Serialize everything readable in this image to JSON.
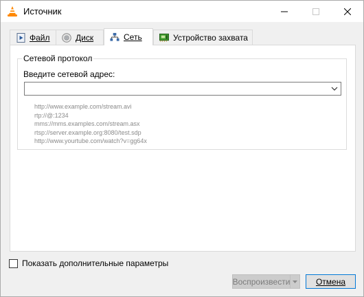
{
  "window": {
    "title": "Источник"
  },
  "tabs": [
    {
      "label": "Файл",
      "icon": "file-play-icon"
    },
    {
      "label": "Диск",
      "icon": "disc-icon"
    },
    {
      "label": "Сеть",
      "icon": "network-icon",
      "selected": true
    },
    {
      "label": "Устройство захвата",
      "icon": "capture-card-icon"
    }
  ],
  "network": {
    "group_title": "Сетевой протокол",
    "address_label": "Введите сетевой адрес:",
    "address_value": "",
    "examples": [
      "http://www.example.com/stream.avi",
      "rtp://@:1234",
      "mms://mms.examples.com/stream.asx",
      "rtsp://server.example.org:8080/test.sdp",
      "http://www.yourtube.com/watch?v=gg64x"
    ]
  },
  "footer": {
    "advanced_label": "Показать дополнительные параметры",
    "advanced_checked": false,
    "play_label": "Воспроизвести",
    "cancel_label": "Отмена"
  },
  "colors": {
    "vlc_orange": "#ff8800",
    "default_button_border": "#0078d7",
    "disabled_button": "#cccccc"
  }
}
